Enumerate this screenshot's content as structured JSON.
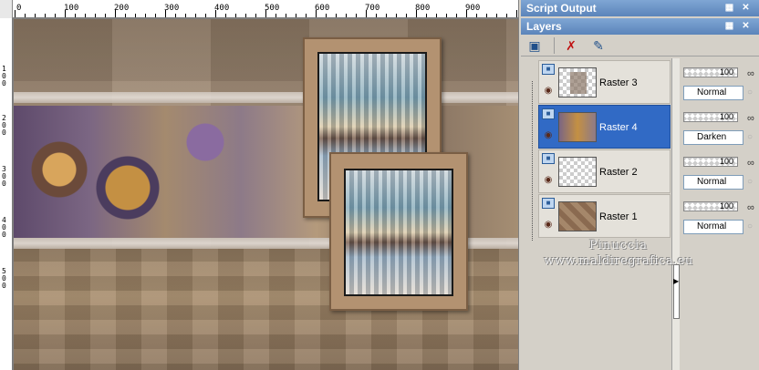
{
  "ruler": {
    "top_labels": [
      "0",
      "100",
      "200",
      "300",
      "400",
      "500",
      "600",
      "700",
      "800",
      "900"
    ],
    "left_labels": [
      "1\n0\n0",
      "2\n0\n0",
      "3\n0\n0",
      "4\n0\n0",
      "5\n0\n0"
    ]
  },
  "script_output": {
    "title": "Script Output",
    "pin_icon": "pin-icon",
    "close_icon": "close-icon"
  },
  "layers_panel": {
    "title": "Layers",
    "toolbar": {
      "new_layer_icon": "new-raster-layer-icon",
      "delete_icon": "delete-layer-icon",
      "mask_icon": "mask-edit-icon"
    },
    "layers": [
      {
        "name": "Raster 3",
        "opacity": "100",
        "blend": "Normal",
        "selected": false,
        "thumb": "frames"
      },
      {
        "name": "Raster 4",
        "opacity": "100",
        "blend": "Darken",
        "selected": true,
        "thumb": "art"
      },
      {
        "name": "Raster 2",
        "opacity": "100",
        "blend": "Normal",
        "selected": false,
        "thumb": "empty"
      },
      {
        "name": "Raster 1",
        "opacity": "100",
        "blend": "Normal",
        "selected": false,
        "thumb": "tiles"
      }
    ]
  },
  "watermark": {
    "line1": "Pinuccia",
    "line2": "www.maldiregrafica.eu"
  },
  "colors": {
    "selected_row": "#316ac5",
    "titlebar": "#5b84ba",
    "canvas_bg": "#a58e73"
  }
}
